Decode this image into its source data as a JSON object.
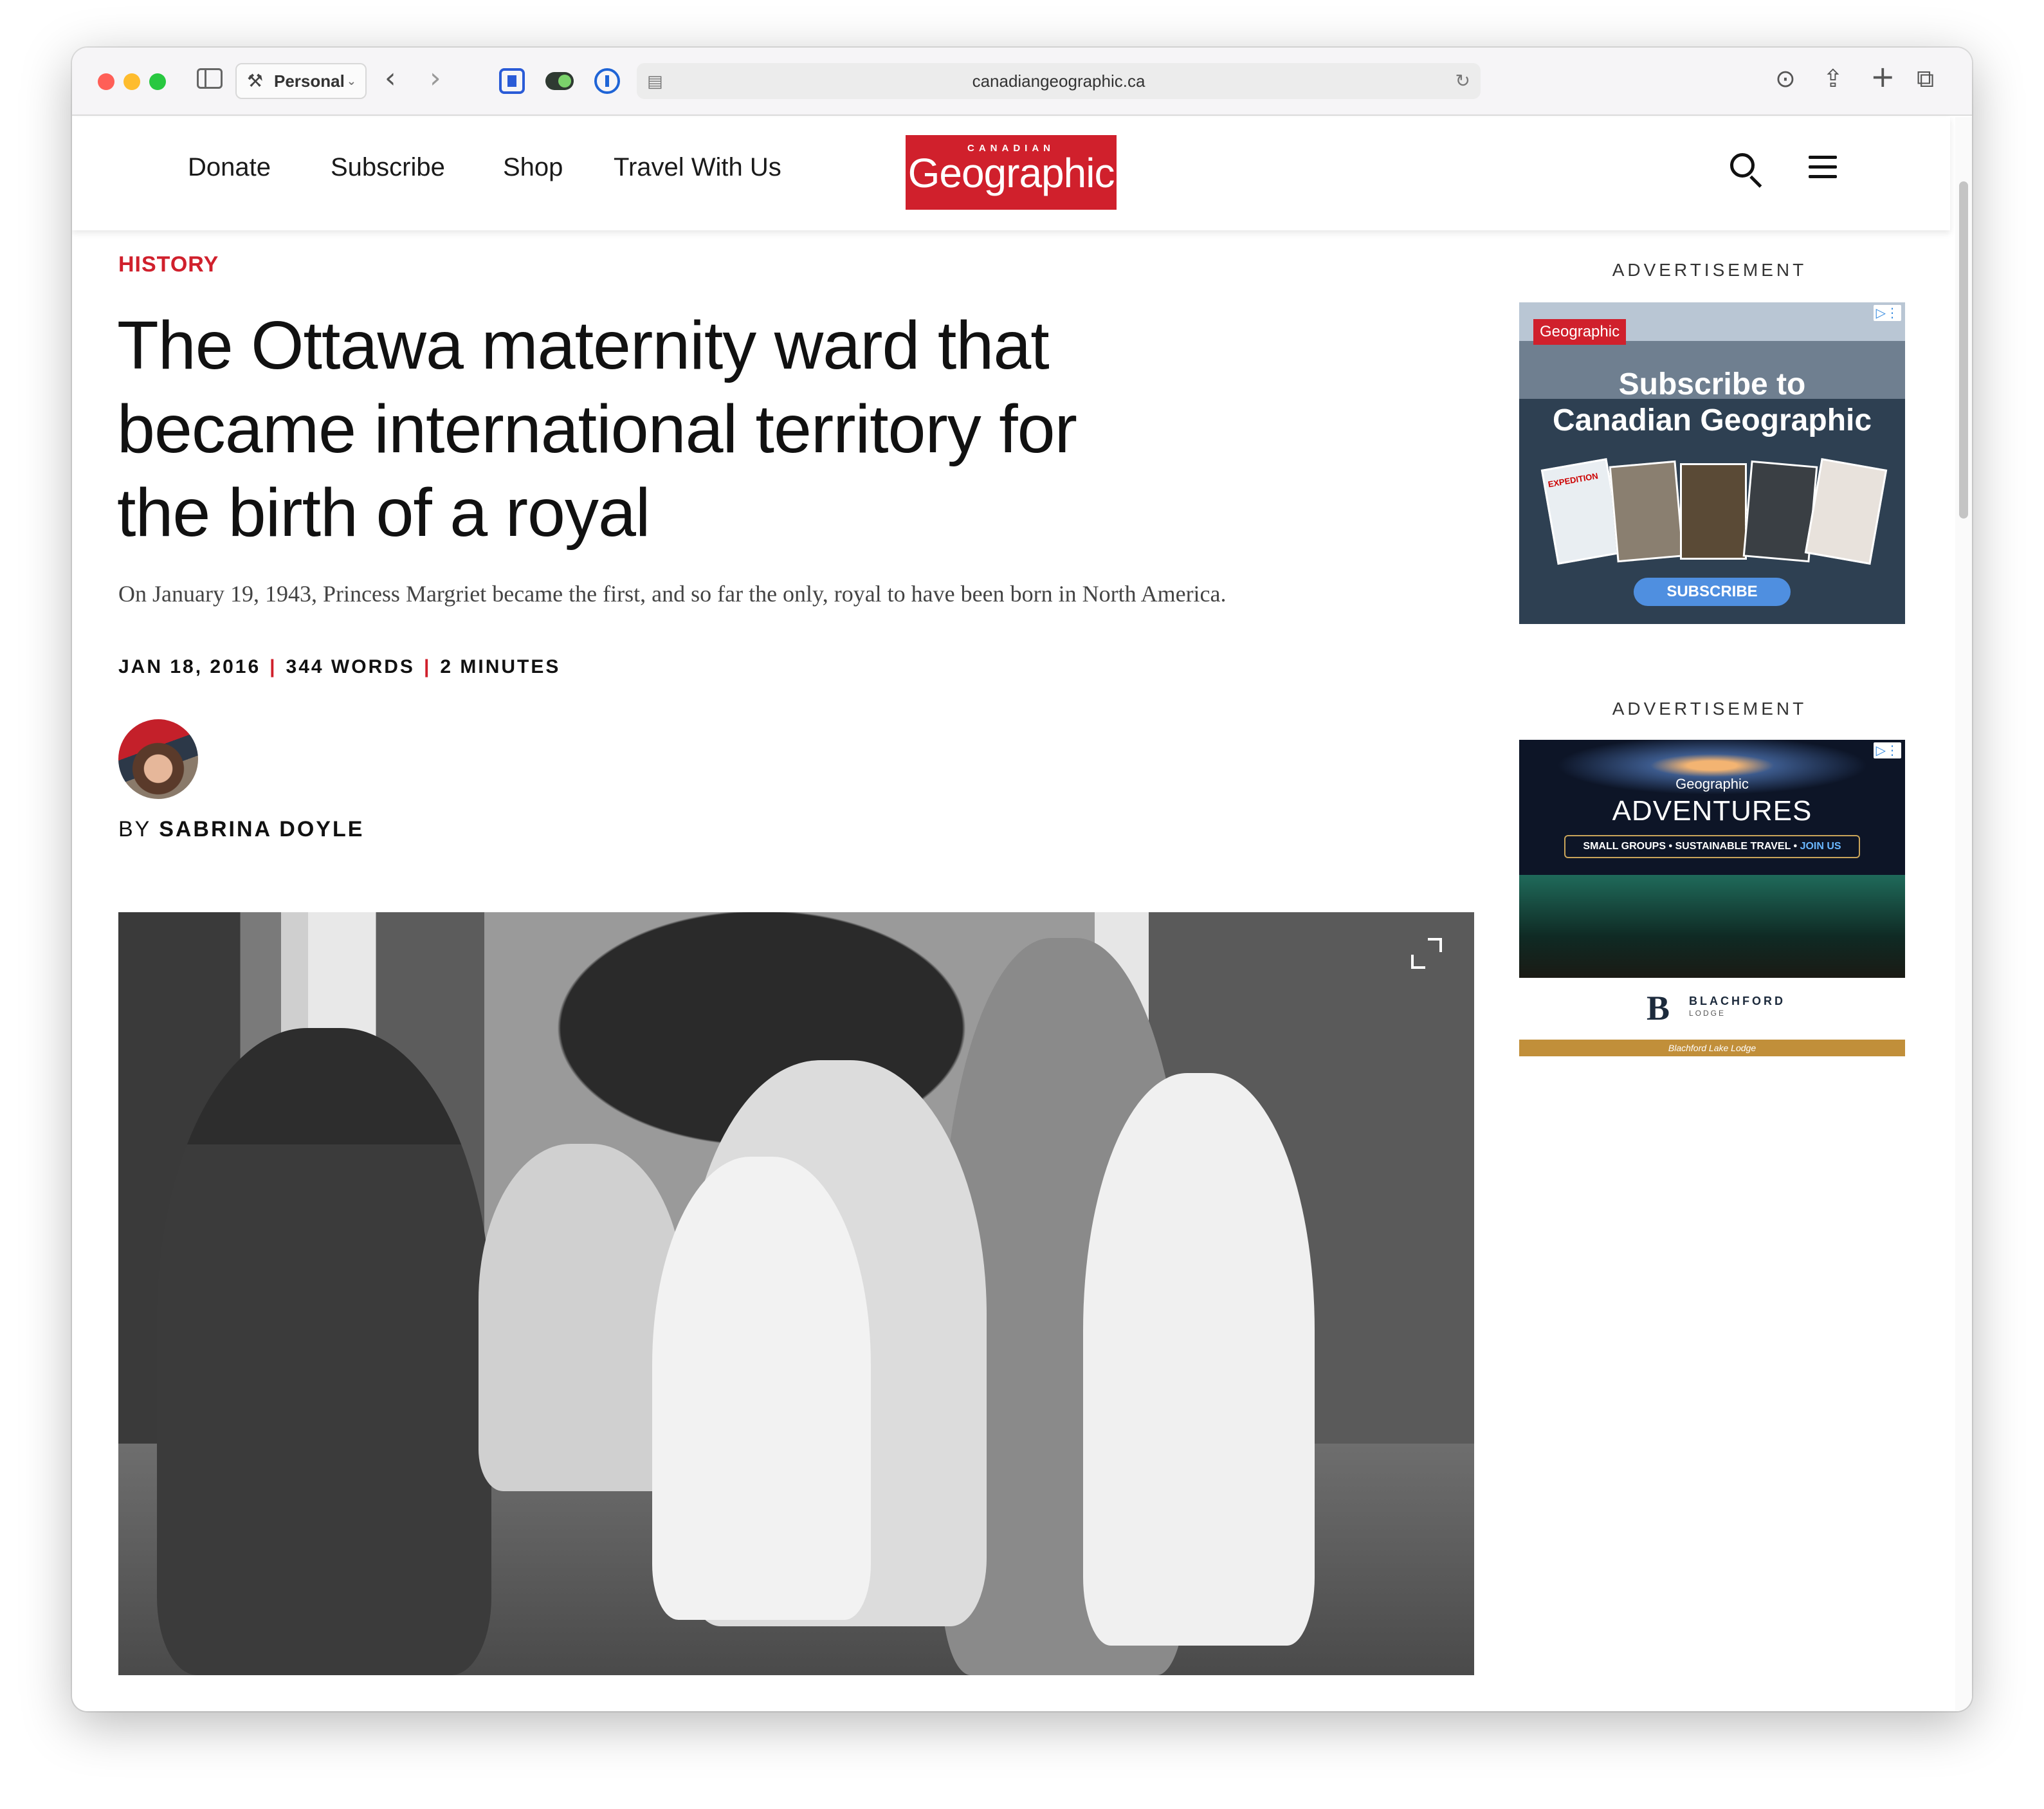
{
  "browser": {
    "profile_label": "Personal",
    "url": "canadiangeographic.ca"
  },
  "site": {
    "nav": [
      "Donate",
      "Subscribe",
      "Shop",
      "Travel With Us"
    ],
    "logo_small": "CANADIAN",
    "logo_big": "Geographic",
    "brand_color": "#d0202c"
  },
  "article": {
    "category": "HISTORY",
    "headline": "The Ottawa maternity ward that became international territory for the birth of a royal",
    "dek": "On January 19, 1943, Princess Margriet became the first, and so far the only, royal to have been born in North America.",
    "date": "JAN 18, 2016",
    "words": "344 WORDS",
    "minutes": "2 MINUTES",
    "byline_prefix": "BY",
    "author": "SABRINA DOYLE"
  },
  "sidebar": {
    "ad_label": "ADVERTISEMENT",
    "ad1": {
      "logo": "Geographic",
      "title_line1": "Subscribe to",
      "title_line2": "Canadian Geographic",
      "cta": "SUBSCRIBE",
      "magazine_cover_text": "EXPEDITION"
    },
    "ad2": {
      "brand": "Geographic",
      "title": "ADVENTURES",
      "tagline": "SMALL GROUPS • SUSTAINABLE TRAVEL • ",
      "tagline_cta": "JOIN US",
      "lodge_mono": "B",
      "lodge_name": "BLACHFORD",
      "lodge_sub": "LODGE",
      "bottom_bar": "Blachford Lake Lodge"
    }
  }
}
